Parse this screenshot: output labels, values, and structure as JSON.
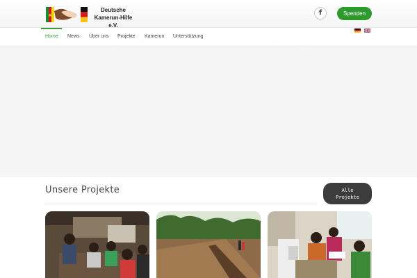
{
  "header": {
    "logo_line1": "Deutsche",
    "logo_line2": "Kamerun-Hilfe e.V.",
    "facebook_glyph": "f",
    "donate_label": "Spenden"
  },
  "nav": {
    "items": [
      {
        "label": "Home",
        "active": true
      },
      {
        "label": "News"
      },
      {
        "label": "Über uns"
      },
      {
        "label": "Projekte"
      },
      {
        "label": "Kamerun"
      },
      {
        "label": "Unterstützung"
      }
    ],
    "languages": [
      "de-flag-icon",
      "uk-flag-icon"
    ]
  },
  "projects": {
    "title": "Unsere Projekte",
    "all_button_line1": "Alle",
    "all_button_line2": "Projekte",
    "cards": [
      {
        "image": "workshop-photo"
      },
      {
        "image": "construction-trench-photo"
      },
      {
        "image": "sewing-class-photo"
      }
    ]
  },
  "colors": {
    "accent_green": "#2e9a2e",
    "dark_button": "#3c3c3c"
  }
}
